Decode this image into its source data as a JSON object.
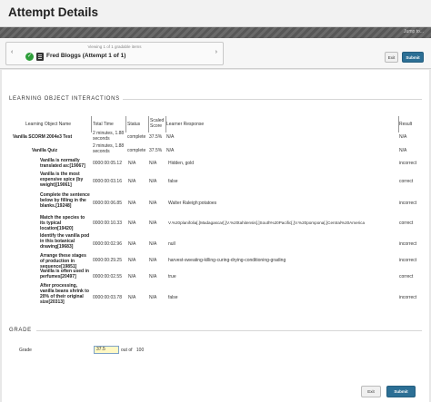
{
  "page": {
    "title": "Attempt Details"
  },
  "topbar": {
    "jump_label": "Jump to..."
  },
  "nav": {
    "viewing_text": "Viewing 1 of 1 gradable items",
    "learner_label": "Fred Bloggs (Attempt 1 of 1)",
    "prev_icon": "‹",
    "next_icon": "›",
    "exit_label": "Exit",
    "submit_label": "Submit"
  },
  "section": {
    "title": "LEARNING OBJECT INTERACTIONS",
    "headers": [
      "Learning Object Name",
      "Total Time",
      "Status",
      "Scaled Score",
      "Learner Response",
      "Result"
    ]
  },
  "rows": [
    {
      "name": "Vanilla SCORM 2004e3 Test",
      "time": "2 minutes, 1.88 seconds",
      "status": "complete",
      "score": "37.5%",
      "response": "N/A",
      "result": "N/A"
    },
    {
      "name": "Vanilla Quiz",
      "time": "2 minutes, 1.88 seconds",
      "status": "complete",
      "score": "37.5%",
      "response": "N/A",
      "result": "N/A"
    },
    {
      "name": "Vanilla is normally translated as:[19067]",
      "time": "0000:00:05.12",
      "status": "N/A",
      "score": "N/A",
      "response": "Hidden, gold",
      "result": "incorrect"
    },
    {
      "name": "Vanilla is the most expensive spice (by weight)[19061]",
      "time": "0000:00:03.16",
      "status": "N/A",
      "score": "N/A",
      "response": "false",
      "result": "correct"
    },
    {
      "name": "Complete the sentence below by filling in the blanks.[19248]",
      "time": "0000:00:06.85",
      "status": "N/A",
      "score": "N/A",
      "response": "Walter Raleigh;potatoes",
      "result": "incorrect"
    },
    {
      "name": "Match the species to its typical location[19420]",
      "time": "0000:00:10.33",
      "status": "N/A",
      "score": "N/A",
      "response": "V.%20planifolia[.]Madagascar[,]V.%20tahitensis[.]South%20Pacific[,]V.%20pompona[.]Central%20America",
      "result": "correct"
    },
    {
      "name": "Identify the vanilla pod in this botanical drawing[19683]",
      "time": "0000:00:02.96",
      "status": "N/A",
      "score": "N/A",
      "response": "null",
      "result": "incorrect"
    },
    {
      "name": "Arrange these stages of production in sequence[19851]",
      "time": "0000:00:29.25",
      "status": "N/A",
      "score": "N/A",
      "response": "harvest-sweating-killing-curing-drying-conditioning-grading",
      "result": "incorrect"
    },
    {
      "name": "Vanilla is often used in perfumes[20497]",
      "time": "0000:00:02.55",
      "status": "N/A",
      "score": "N/A",
      "response": "true",
      "result": "correct"
    },
    {
      "name": "After processing, vanilla beans shrink to 20% of their original size[20313]",
      "time": "0000:00:03.78",
      "status": "N/A",
      "score": "N/A",
      "response": "false",
      "result": "incorrect"
    }
  ],
  "grade": {
    "section_title": "GRADE",
    "label": "Grade",
    "value": "37.5",
    "out_of": "out of",
    "max": "100"
  },
  "footer": {
    "exit_label": "Exit",
    "submit_label": "Submit"
  }
}
